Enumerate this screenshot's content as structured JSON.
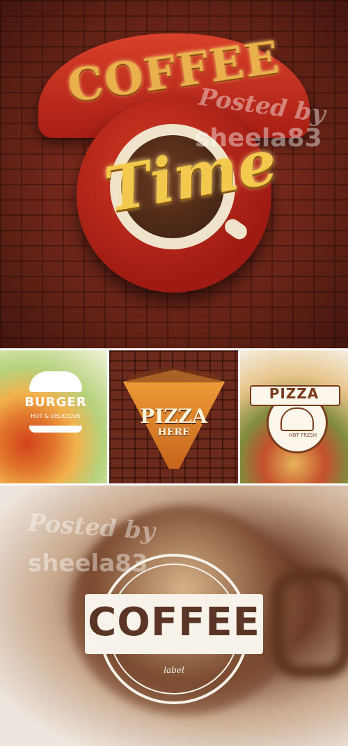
{
  "top_sign": {
    "word1": "COFFEE",
    "word2": "Time"
  },
  "watermark": {
    "line1": "Posted by",
    "line2": "sheela83"
  },
  "burger": {
    "title": "BURGER",
    "subtitle": "HOT & DELICIOUS"
  },
  "pizza_sign": {
    "title": "PIZZA",
    "subtitle": "HERE"
  },
  "pizza_logo": {
    "title": "PIZZA",
    "subtitle": "HOT FRESH"
  },
  "coffee_emblem": {
    "title": "COFFEE",
    "subtitle": "label"
  },
  "colors": {
    "brick": "#7a2a1c",
    "sign_red": "#c42c1c",
    "marquee_gold": "#f2c94c",
    "coffee_brown": "#5a3526"
  }
}
